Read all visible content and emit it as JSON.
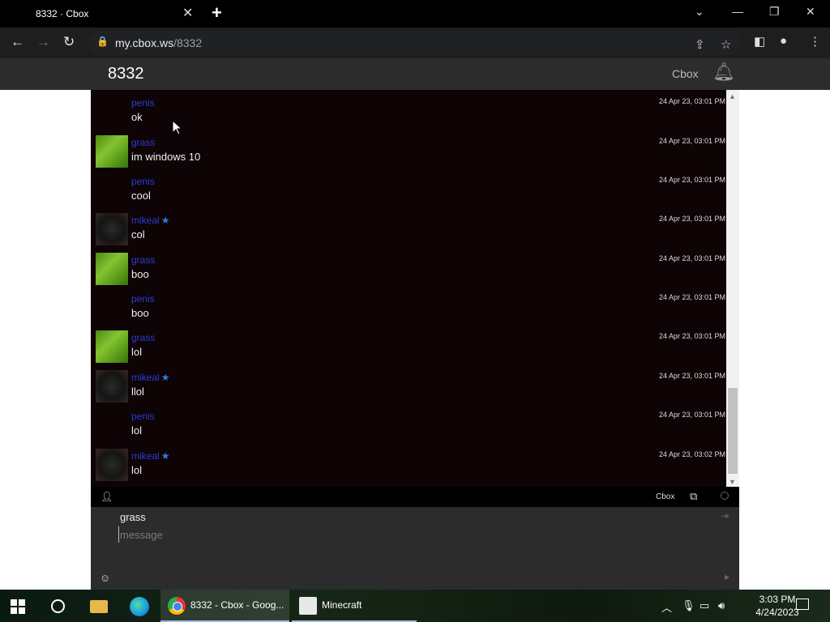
{
  "browser": {
    "tab_title": "8332 · Cbox",
    "tab_close": "✕",
    "new_tab": "+",
    "url_host": "my.cbox.ws",
    "url_path": "/8332"
  },
  "header": {
    "box_name": "8332",
    "brand": "Cbox"
  },
  "messages": [
    {
      "user": "penis",
      "avatar": "none",
      "starred": false,
      "text": "ok",
      "time": "24 Apr 23, 03:01 PM"
    },
    {
      "user": "grass",
      "avatar": "grass",
      "starred": false,
      "text": "im windows 10",
      "time": "24 Apr 23, 03:01 PM"
    },
    {
      "user": "penis",
      "avatar": "none",
      "starred": false,
      "text": "cool",
      "time": "24 Apr 23, 03:01 PM"
    },
    {
      "user": "mikeal",
      "avatar": "mikeal",
      "starred": true,
      "text": "col",
      "time": "24 Apr 23, 03:01 PM"
    },
    {
      "user": "grass",
      "avatar": "grass",
      "starred": false,
      "text": "boo",
      "time": "24 Apr 23, 03:01 PM"
    },
    {
      "user": "penis",
      "avatar": "none",
      "starred": false,
      "text": "boo",
      "time": "24 Apr 23, 03:01 PM"
    },
    {
      "user": "grass",
      "avatar": "grass",
      "starred": false,
      "text": "lol",
      "time": "24 Apr 23, 03:01 PM"
    },
    {
      "user": "mikeal",
      "avatar": "mikeal",
      "starred": true,
      "text": "llol",
      "time": "24 Apr 23, 03:01 PM"
    },
    {
      "user": "penis",
      "avatar": "none",
      "starred": false,
      "text": "lol",
      "time": "24 Apr 23, 03:01 PM"
    },
    {
      "user": "mikeal",
      "avatar": "mikeal",
      "starred": true,
      "text": "lol",
      "time": "24 Apr 23, 03:02 PM"
    }
  ],
  "toolbar": {
    "brand": "Cbox"
  },
  "compose": {
    "name": "grass",
    "placeholder": "message"
  },
  "taskbar": {
    "chrome_label": "8332 - Cbox - Goog...",
    "minecraft_label": "Minecraft",
    "time": "3:03 PM",
    "date": "4/24/2023"
  },
  "icons": {
    "user": "user-icon",
    "bell": "bell-icon",
    "star": "star-icon"
  }
}
